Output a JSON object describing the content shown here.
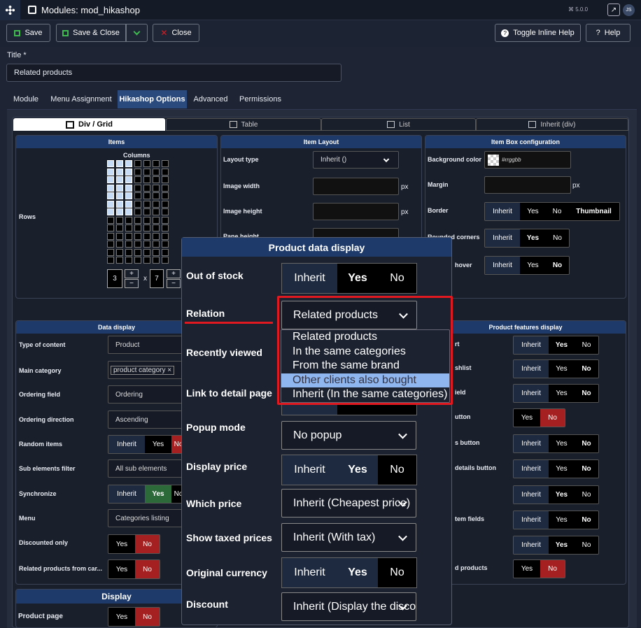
{
  "app": {
    "title": "Modules: mod_hikashop",
    "version": "⌘ 5.0.0",
    "avatar": "JS"
  },
  "toolbar": {
    "save": "Save",
    "save_close": "Save & Close",
    "close": "Close",
    "inline_help": "Toggle Inline Help",
    "help": "Help"
  },
  "title_field": {
    "label": "Title *",
    "value": "Related products"
  },
  "tabs": [
    "Module",
    "Menu Assignment",
    "Hikashop Options",
    "Advanced",
    "Permissions"
  ],
  "subtabs": [
    "Div / Grid",
    "Table",
    "List",
    "Inherit (div)"
  ],
  "items_panel": {
    "title": "Items",
    "columns": "Columns",
    "rows": "Rows",
    "rows_value": "3",
    "cols_value": "7",
    "x": "x",
    "plus": "+",
    "minus": "−",
    "selected_cols": 3,
    "selected_rows": 7
  },
  "item_layout": {
    "title": "Item Layout",
    "layout_type": "Layout type",
    "layout_value": "Inherit ()",
    "image_width": "Image width",
    "image_height": "Image height",
    "pane_height": "Pane height",
    "px": "px"
  },
  "item_box": {
    "title": "Item Box configuration",
    "bg_label": "Background color",
    "bg_value": "#rrggbb",
    "margin": "Margin",
    "border": "Border",
    "rounded": "Rounded corners",
    "hover": "hover",
    "px": "px",
    "inherit": "Inherit",
    "yes": "Yes",
    "no": "No",
    "thumbnail": "Thumbnail"
  },
  "data_display": {
    "title": "Data display",
    "type_label": "Type of content",
    "type_value": "Product",
    "main_cat": "Main category",
    "main_cat_value": "product category ×",
    "ordering_field": "Ordering field",
    "ordering_value": "Ordering",
    "ordering_dir": "Ordering direction",
    "ordering_dir_value": "Ascending",
    "random": "Random items",
    "sub_filter": "Sub elements filter",
    "sub_value": "All sub elements",
    "sync": "Synchronize",
    "menu": "Menu",
    "menu_value": "Categories listing",
    "discounted": "Discounted only",
    "related_cart": "Related products from car...",
    "inherit": "Inherit",
    "yes": "Yes",
    "no": "No"
  },
  "display": {
    "title": "Display",
    "product_page": "Product page",
    "yes": "Yes",
    "no": "No"
  },
  "features": {
    "title": "Product features display",
    "labels": [
      "rt",
      "shlist",
      "ield",
      "utton",
      "s button",
      "details button",
      "",
      "tem fields",
      "",
      "d products"
    ],
    "inherit": "Inherit",
    "yes": "Yes",
    "no": "No"
  },
  "modal": {
    "title": "Product data display",
    "out_of_stock": "Out of stock",
    "relation": "Relation",
    "relation_value": "Related products",
    "recently_viewed": "Recently viewed",
    "link_detail": "Link to detail page",
    "popup": "Popup mode",
    "popup_value": "No popup",
    "display_price": "Display price",
    "which_price": "Which price",
    "which_price_value": "Inherit (Cheapest price)",
    "taxed": "Show taxed prices",
    "taxed_value": "Inherit (With tax)",
    "orig_currency": "Original currency",
    "discount": "Discount",
    "discount_value": "Inherit (Display the discount amount)",
    "inherit": "Inherit",
    "yes": "Yes",
    "no": "No",
    "hidden_yes": "Yes",
    "hidden_no": "No"
  },
  "dropdown": {
    "options": [
      "Related products",
      "In the same categories",
      "From the same brand",
      "Other clients also bought",
      "Inherit (In the same categories)"
    ],
    "highlighted": 3
  },
  "colors": {
    "accent": "#1d3a6b",
    "highlight": "#8fb6ef",
    "red": "#e0181f",
    "no_red": "#a52020",
    "green": "#2d6a3a"
  }
}
